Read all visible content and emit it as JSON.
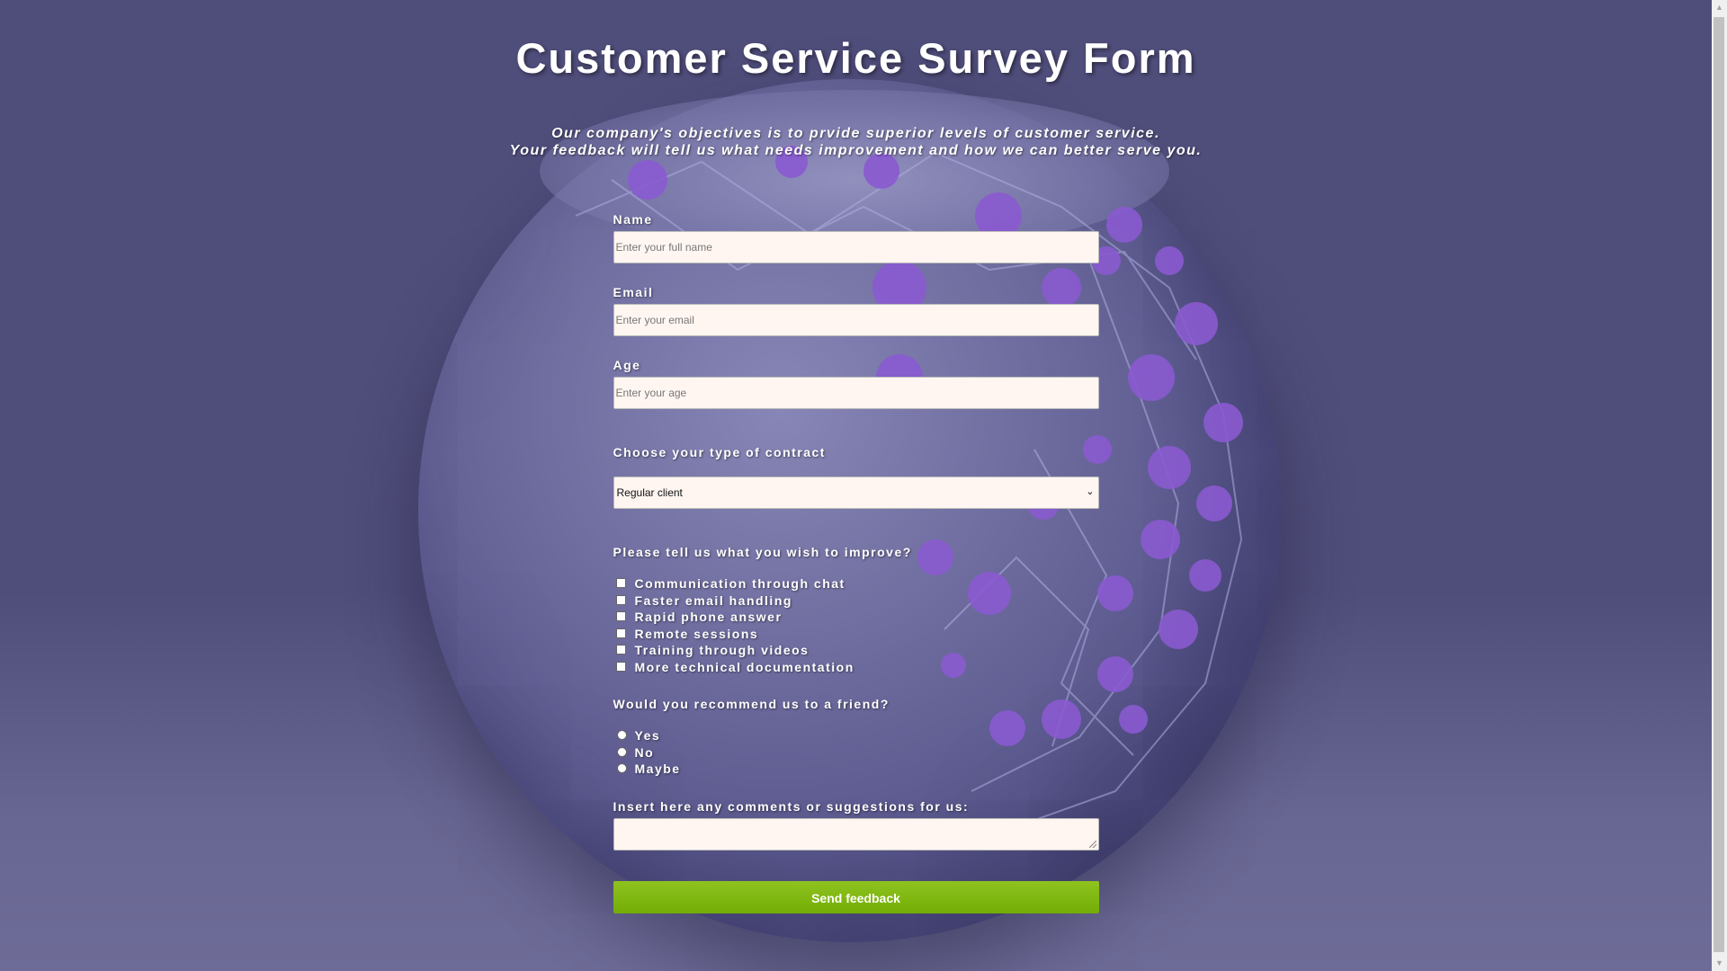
{
  "title": "Customer Service Survey Form",
  "description": {
    "line1": "Our company's objectives is to prvide superior levels of customer service.",
    "line2": "Your feedback will tell us what needs improvement and how we can better serve you."
  },
  "fields": {
    "name": {
      "label": "Name",
      "placeholder": "Enter your full name"
    },
    "email": {
      "label": "Email",
      "placeholder": "Enter your email"
    },
    "age": {
      "label": "Age",
      "placeholder": "Enter your age"
    }
  },
  "contract": {
    "label": "Choose your type of contract",
    "selected": "Regular client"
  },
  "improve": {
    "label": "Please tell us what you wish to improve?",
    "options": [
      "Communication through chat",
      "Faster email handling",
      "Rapid phone answer",
      "Remote sessions",
      "Training through videos",
      "More technical documentation"
    ]
  },
  "recommend": {
    "label": "Would you recommend us to a friend?",
    "options": [
      "Yes",
      "No",
      "Maybe"
    ]
  },
  "comments": {
    "label": "Insert here any comments or suggestions for us:"
  },
  "submit_label": "Send feedback",
  "colors": {
    "background": "#4f4d7a",
    "button": "#7cb40e",
    "field_background": "#fff6f2"
  }
}
